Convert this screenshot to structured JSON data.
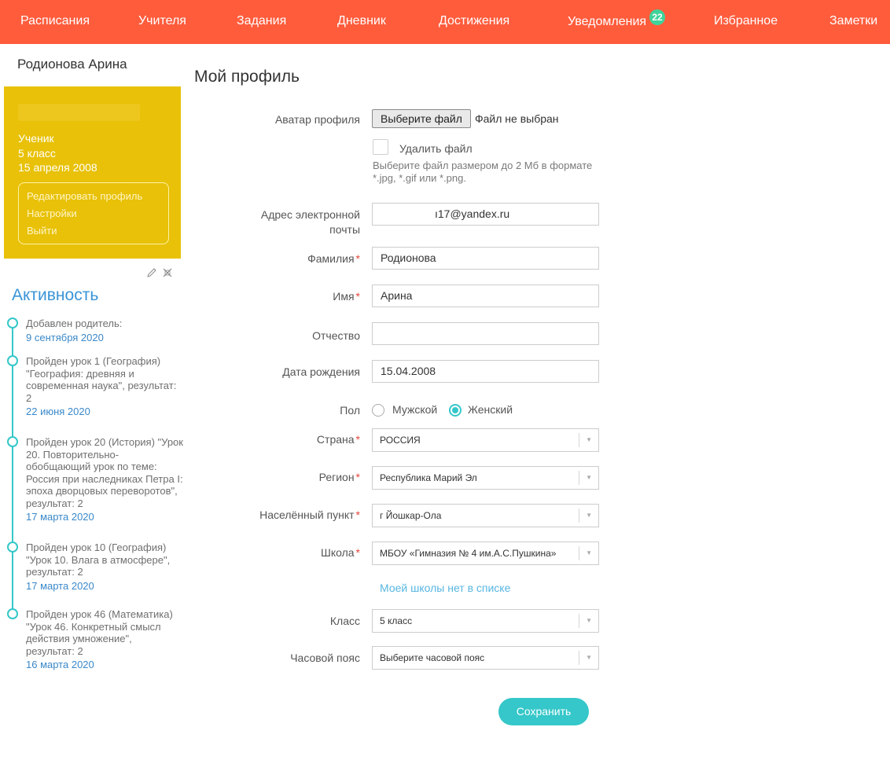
{
  "nav": {
    "items": [
      {
        "label": "Расписания"
      },
      {
        "label": "Учителя"
      },
      {
        "label": "Задания"
      },
      {
        "label": "Дневник"
      },
      {
        "label": "Достижения"
      },
      {
        "label": "Уведомления",
        "badge": "22"
      },
      {
        "label": "Избранное"
      },
      {
        "label": "Заметки"
      }
    ]
  },
  "sidebar": {
    "student_name": "Родионова Арина",
    "role": "Ученик",
    "grade": "5 класс",
    "birthdate": "15 апреля 2008",
    "links": [
      "Редактировать профиль",
      "Настройки",
      "Выйти"
    ],
    "activity_title": "Активность",
    "activity": [
      {
        "text": "Добавлен родитель:",
        "date": "9 сентября 2020"
      },
      {
        "text": "Пройден урок 1 (География) \"География: древняя и современная наука\", результат: 2",
        "date": "22 июня 2020"
      },
      {
        "text": "Пройден урок 20 (История) \"Урок 20. Повторительно-обобщающий урок по теме: Россия при наследниках Петра I: эпоха дворцовых переворотов\", результат: 2",
        "date": "17 марта 2020"
      },
      {
        "text": "Пройден урок 10 (География) \"Урок 10. Влага в атмосфере\", результат: 2",
        "date": "17 марта 2020"
      },
      {
        "text": "Пройден урок 46 (Математика) \"Урок 46. Конкретный смысл действия умножение\", результат: 2",
        "date": "16 марта 2020"
      }
    ]
  },
  "form": {
    "title": "Мой профиль",
    "avatar_label": "Аватар профиля",
    "file_button": "Выберите файл",
    "file_status": "Файл не выбран",
    "delete_file_label": "Удалить файл",
    "file_hint": "Выберите файл размером до 2 Мб в формате *.jpg, *.gif или *.png.",
    "email_label_1": "Адрес электронной",
    "email_label_2": "почты",
    "email_value": "ı17@yandex.ru",
    "lastname_label": "Фамилия",
    "lastname_value": "Родионова",
    "firstname_label": "Имя",
    "firstname_value": "Арина",
    "patronymic_label": "Отчество",
    "patronymic_value": "",
    "birthdate_label": "Дата рождения",
    "birthdate_value": "15.04.2008",
    "gender_label": "Пол",
    "gender_male": "Мужской",
    "gender_female": "Женский",
    "gender_selected": "Женский",
    "country_label": "Страна",
    "country_value": "РОССИЯ",
    "region_label": "Регион",
    "region_value": "Республика Марий Эл",
    "city_label": "Населённый пункт",
    "city_value": "г Йошкар-Ола",
    "school_label": "Школа",
    "school_value": "МБОУ «Гимназия № 4 им.А.С.Пушкина»",
    "school_missing_link": "Моей школы нет в списке",
    "class_label": "Класс",
    "class_value": "5 класс",
    "timezone_label": "Часовой пояс",
    "timezone_value": "Выберите часовой пояс",
    "save_label": "Сохранить",
    "required_mark": "*"
  },
  "colors": {
    "nav_bg": "#ff5c3c",
    "card_bg": "#e8c108",
    "accent": "#35c7c9",
    "badge": "#3ed39a",
    "link": "#3a94d7"
  }
}
